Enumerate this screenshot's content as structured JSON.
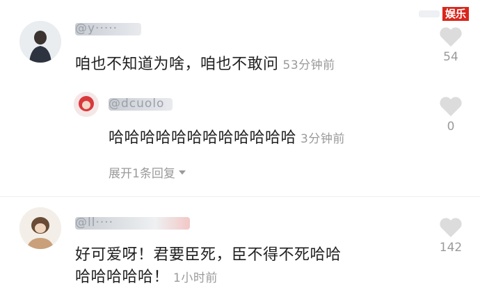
{
  "watermark": {
    "badge": "娱乐"
  },
  "comments": [
    {
      "username": "@y·····",
      "text": "咱也不知道为啥，咱也不敢问",
      "time": "53分钟前",
      "likes": "54"
    },
    {
      "username": "@dcuolo",
      "text": "哈哈哈哈哈哈哈哈哈哈哈哈",
      "time": "3分钟前",
      "likes": "0",
      "expand": "展开1条回复"
    },
    {
      "username": "@ll····",
      "text_line1": "好可爱呀！君要臣死，臣不得不死哈哈",
      "text_line2": "哈哈哈哈哈！",
      "time": "1小时前",
      "likes": "142"
    }
  ],
  "icons": {
    "like": "heart-icon",
    "expand": "caret-down-icon"
  },
  "colors": {
    "accent": "#d9261c",
    "muted": "#9a9a9a",
    "heart": "#dcdcdc"
  }
}
